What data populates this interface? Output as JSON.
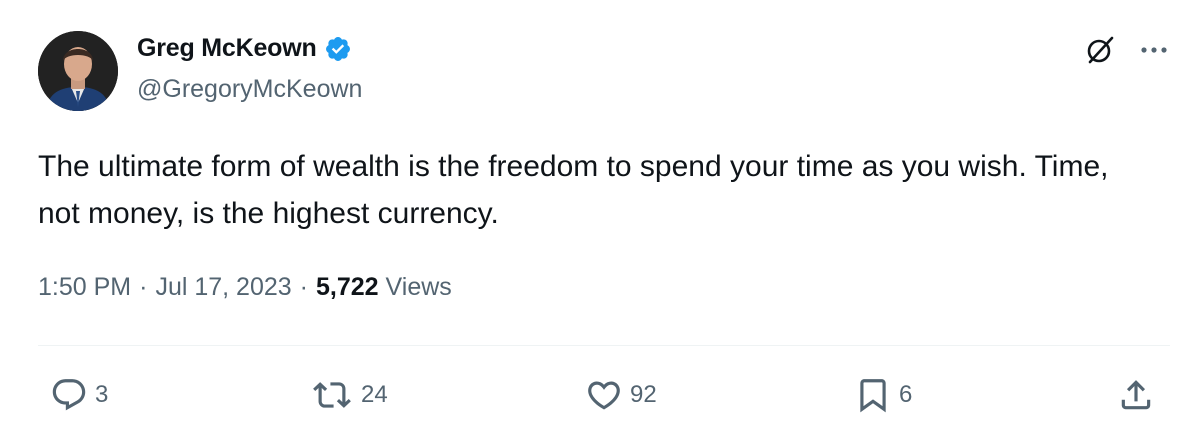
{
  "author": {
    "name": "Greg McKeown",
    "handle": "@GregoryMcKeown",
    "verified": true
  },
  "header_icons": [
    "grok-icon",
    "more-icon"
  ],
  "tweet": {
    "text": "The ultimate form of wealth is the freedom to spend your time as you wish. Time, not money, is the highest currency.",
    "time": "1:50 PM",
    "date": "Jul 17, 2023",
    "separator": "·",
    "views_count": "5,722",
    "views_label": "Views"
  },
  "actions": {
    "replies": "3",
    "reposts": "24",
    "likes": "92",
    "bookmarks": "6"
  },
  "colors": {
    "text": "#0f1419",
    "secondary": "#536471",
    "verified": "#1d9bf0",
    "divider": "#eff3f4"
  }
}
